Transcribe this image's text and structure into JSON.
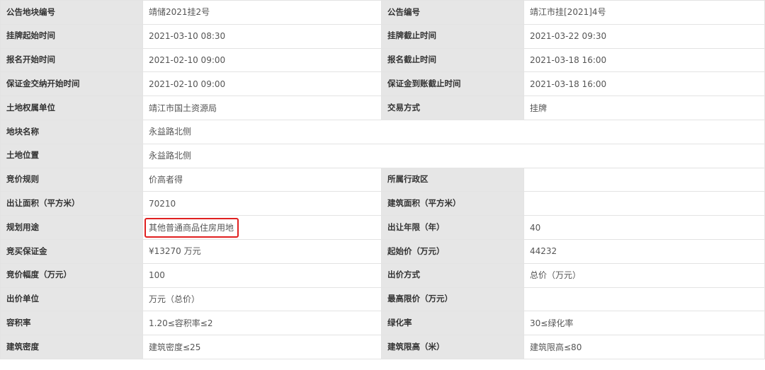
{
  "rows": [
    {
      "l1": "公告地块编号",
      "v1": "靖储2021挂2号",
      "l2": "公告编号",
      "v2": "靖江市挂[2021]4号"
    },
    {
      "l1": "挂牌起始时间",
      "v1": "2021-03-10 08:30",
      "l2": "挂牌截止时间",
      "v2": "2021-03-22 09:30"
    },
    {
      "l1": "报名开始时间",
      "v1": "2021-02-10 09:00",
      "l2": "报名截止时间",
      "v2": "2021-03-18 16:00"
    },
    {
      "l1": "保证金交纳开始时间",
      "v1": "2021-02-10 09:00",
      "l2": "保证金到账截止时间",
      "v2": "2021-03-18 16:00"
    },
    {
      "l1": "土地权属单位",
      "v1": "靖江市国土资源局",
      "l2": "交易方式",
      "v2": "挂牌"
    },
    {
      "l1": "地块名称",
      "v1": "永益路北侧"
    },
    {
      "l1": "土地位置",
      "v1": "永益路北侧"
    },
    {
      "l1": "竞价规则",
      "v1": "价高者得",
      "l2": "所属行政区",
      "v2": ""
    },
    {
      "l1": "出让面积（平方米）",
      "v1": "70210",
      "l2": "建筑面积（平方米）",
      "v2": ""
    },
    {
      "l1": "规划用途",
      "v1": "其他普通商品住房用地",
      "l2": "出让年限（年）",
      "v2": "40"
    },
    {
      "l1": "竞买保证金",
      "v1": "¥13270 万元",
      "l2": "起始价（万元）",
      "v2": "44232"
    },
    {
      "l1": "竞价幅度（万元）",
      "v1": "100",
      "l2": "出价方式",
      "v2": "总价（万元）"
    },
    {
      "l1": "出价单位",
      "v1": "万元（总价）",
      "l2": "最高限价（万元）",
      "v2": ""
    },
    {
      "l1": "容积率",
      "v1": "1.20≤容积率≤2",
      "l2": "绿化率",
      "v2": "30≤绿化率"
    },
    {
      "l1": "建筑密度",
      "v1": "建筑密度≤25",
      "l2": "建筑限高（米）",
      "v2": "建筑限高≤80"
    }
  ],
  "highlight": {
    "row": 9,
    "color": "#e02020"
  }
}
